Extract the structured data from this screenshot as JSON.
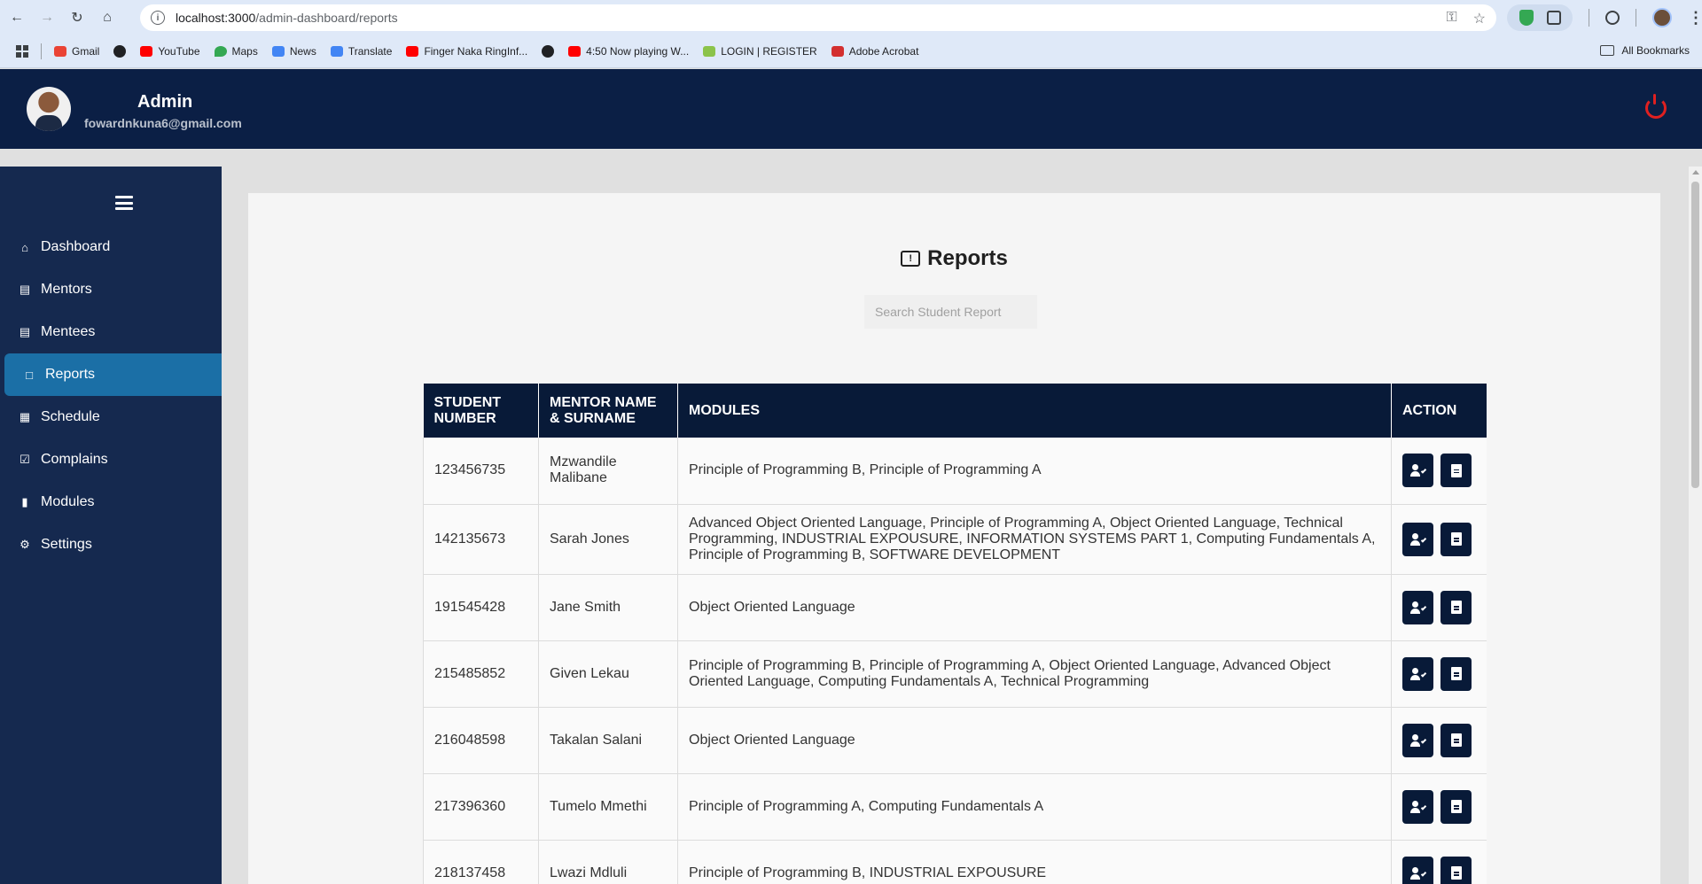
{
  "browser": {
    "url_host": "localhost:3000",
    "url_path": "/admin-dashboard/reports"
  },
  "bookmarks": [
    {
      "label": "Gmail",
      "color": "#ea4335"
    },
    {
      "label": "",
      "color": "#202124"
    },
    {
      "label": "YouTube",
      "color": "#ff0000"
    },
    {
      "label": "Maps",
      "color": "#34a853"
    },
    {
      "label": "News",
      "color": "#4285f4"
    },
    {
      "label": "Translate",
      "color": "#4285f4"
    },
    {
      "label": "Finger Naka RingInf...",
      "color": "#ff0000"
    },
    {
      "label": "",
      "color": "#202124"
    },
    {
      "label": "4:50 Now playing W...",
      "color": "#ff0000"
    },
    {
      "label": "LOGIN | REGISTER",
      "color": "#8bc34a"
    },
    {
      "label": "Adobe Acrobat",
      "color": "#d32f2f"
    }
  ],
  "all_bookmarks": "All Bookmarks",
  "header": {
    "name": "Admin",
    "email": "fowardnkuna6@gmail.com"
  },
  "sidebar": {
    "items": [
      {
        "label": "Dashboard",
        "icon": "home-icon"
      },
      {
        "label": "Mentors",
        "icon": "id-card-icon"
      },
      {
        "label": "Mentees",
        "icon": "id-card-icon"
      },
      {
        "label": "Reports",
        "icon": "chat-alert-icon"
      },
      {
        "label": "Schedule",
        "icon": "calendar-icon"
      },
      {
        "label": "Complains",
        "icon": "clipboard-icon"
      },
      {
        "label": "Modules",
        "icon": "book-icon"
      },
      {
        "label": "Settings",
        "icon": "gear-icon"
      }
    ],
    "active": "Reports"
  },
  "page": {
    "title": "Reports",
    "search_placeholder": "Search Student Report"
  },
  "table": {
    "headers": [
      "STUDENT NUMBER",
      "MENTOR NAME & SURNAME",
      "MODULES",
      "ACTION"
    ],
    "rows": [
      {
        "student": "123456735",
        "mentor": "Mzwandile Malibane",
        "modules": "Principle of Programming B, Principle of Programming A"
      },
      {
        "student": "142135673",
        "mentor": "Sarah Jones",
        "modules": "Advanced Object Oriented Language, Principle of Programming A, Object Oriented Language, Technical Programming, INDUSTRIAL EXPOUSURE, INFORMATION SYSTEMS PART 1, Computing Fundamentals A, Principle of Programming B, SOFTWARE DEVELOPMENT"
      },
      {
        "student": "191545428",
        "mentor": "Jane Smith",
        "modules": "Object Oriented Language"
      },
      {
        "student": "215485852",
        "mentor": "Given Lekau",
        "modules": "Principle of Programming B, Principle of Programming A, Object Oriented Language, Advanced Object Oriented Language, Computing Fundamentals A, Technical Programming"
      },
      {
        "student": "216048598",
        "mentor": "Takalan Salani",
        "modules": "Object Oriented Language"
      },
      {
        "student": "217396360",
        "mentor": "Tumelo Mmethi",
        "modules": "Principle of Programming A, Computing Fundamentals A"
      },
      {
        "student": "218137458",
        "mentor": "Lwazi Mdluli",
        "modules": "Principle of Programming B, INDUSTRIAL EXPOUSURE"
      }
    ]
  },
  "colors": {
    "header_bg": "#0b1f45",
    "sidebar_bg": "#15294f",
    "active_item": "#1b6fa6",
    "table_header": "#081a38",
    "power": "#e02020"
  }
}
